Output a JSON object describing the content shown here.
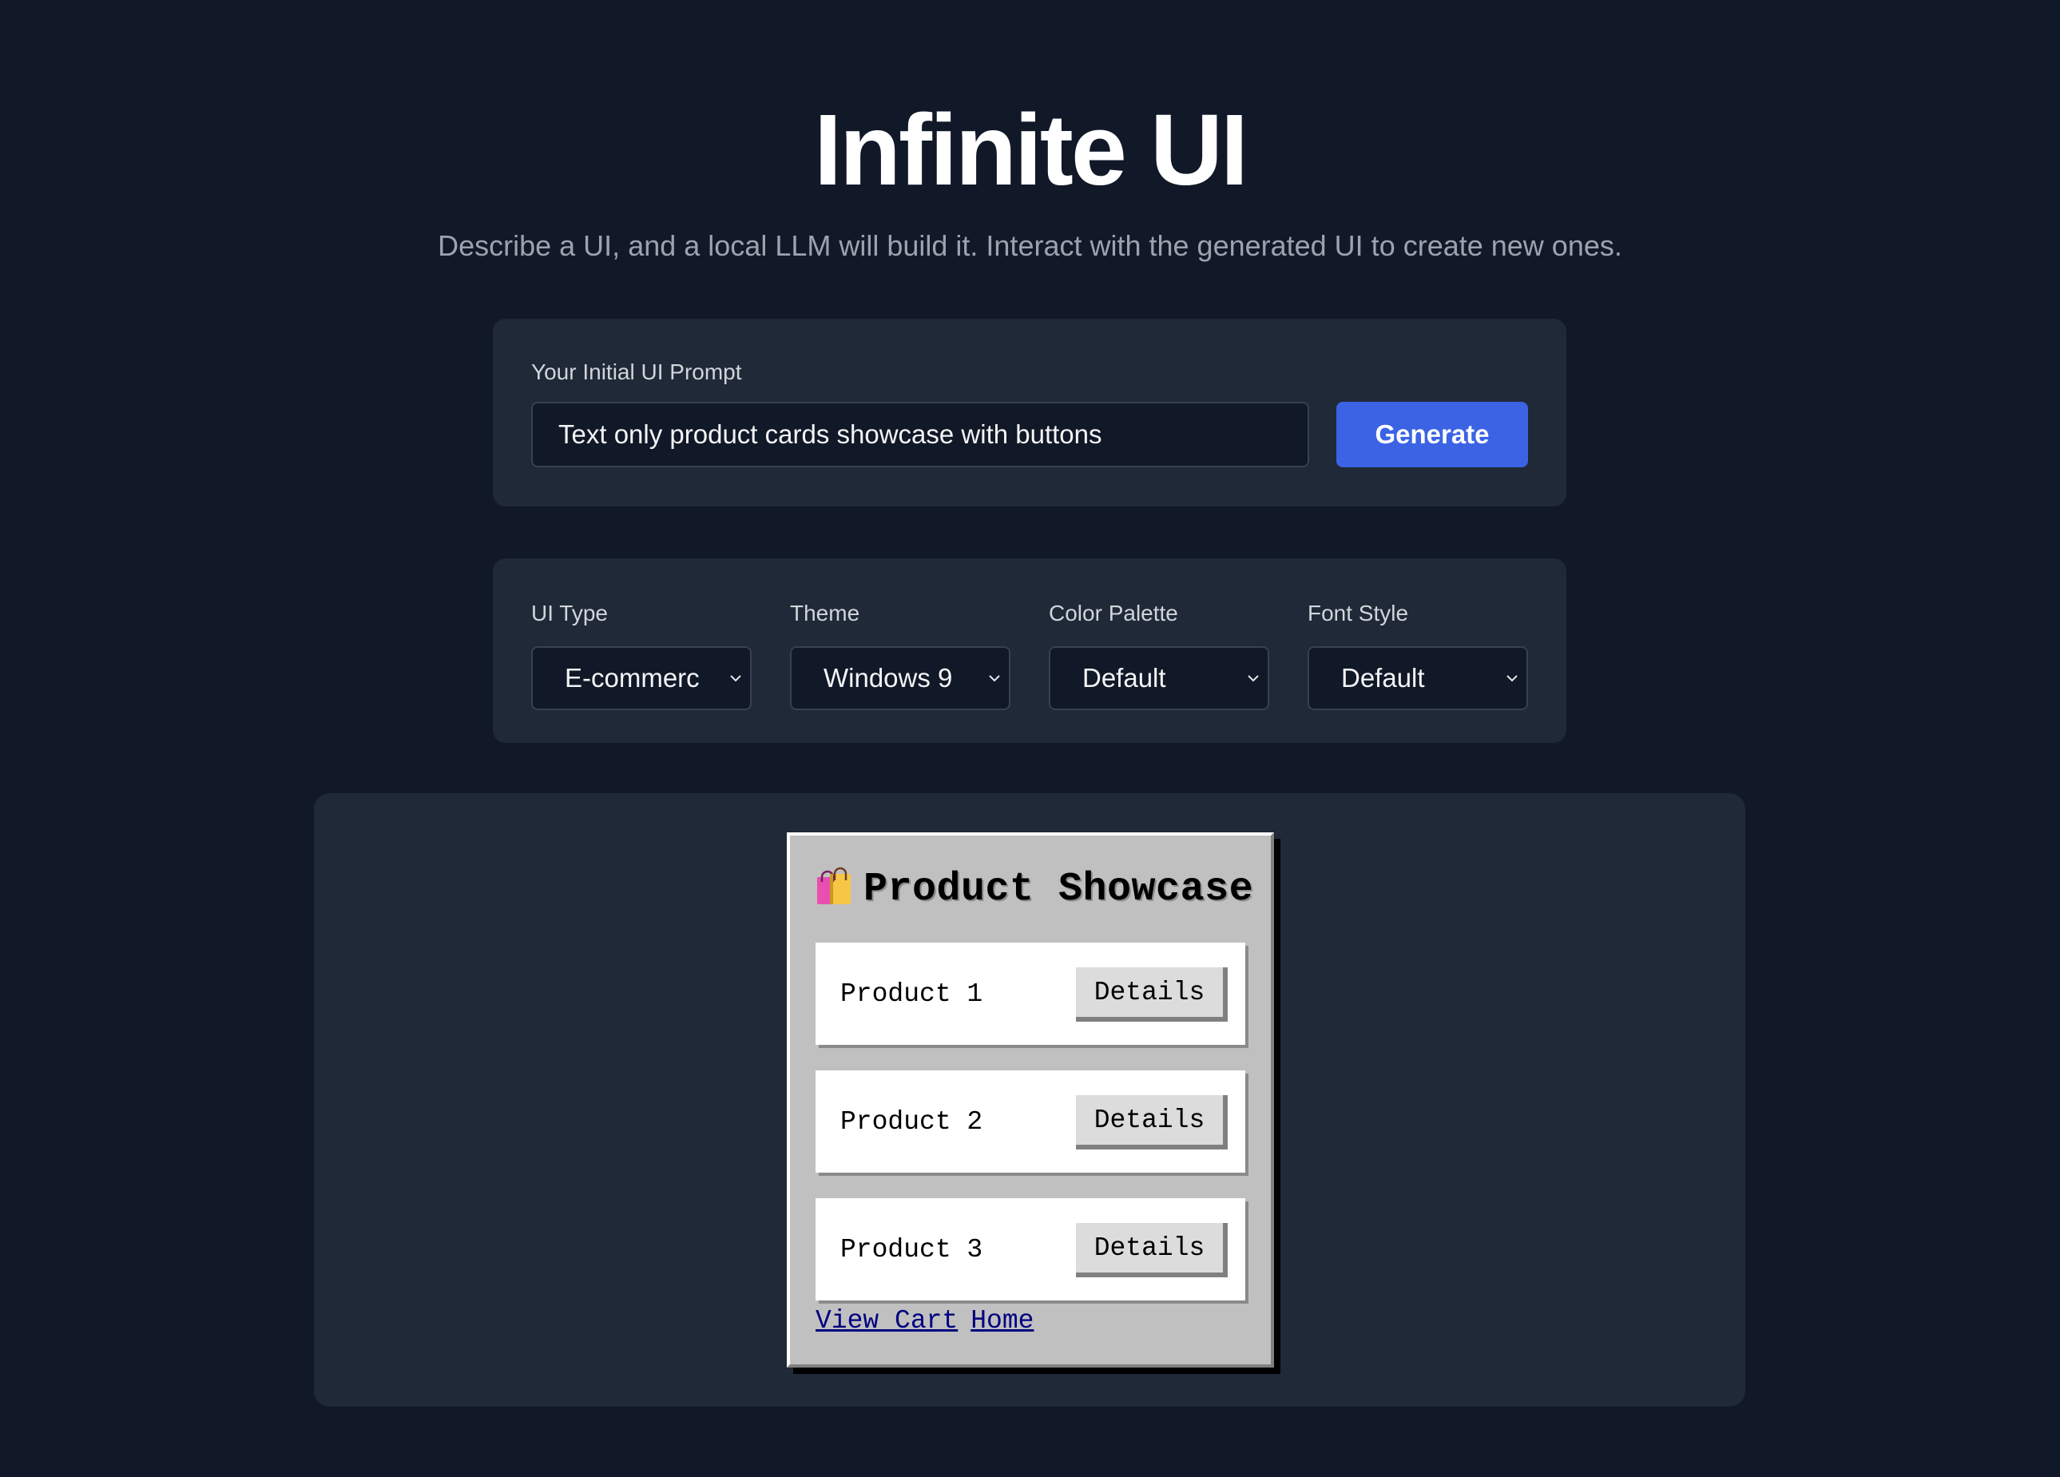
{
  "header": {
    "title": "Infinite UI",
    "subtitle": "Describe a UI, and a local LLM will build it. Interact with the generated UI to create new ones."
  },
  "prompt": {
    "label": "Your Initial UI Prompt",
    "value": "Text only product cards showcase with buttons",
    "generate_label": "Generate"
  },
  "options": [
    {
      "label": "UI Type",
      "value": "E-commerc"
    },
    {
      "label": "Theme",
      "value": "Windows 9"
    },
    {
      "label": "Color Palette",
      "value": "Default"
    },
    {
      "label": "Font Style",
      "value": "Default"
    }
  ],
  "preview": {
    "title": "Product Showcase",
    "icon": "shopping-bags-icon",
    "cards": [
      {
        "name": "Product 1",
        "button": "Details"
      },
      {
        "name": "Product 2",
        "button": "Details"
      },
      {
        "name": "Product 3",
        "button": "Details"
      }
    ],
    "links": [
      "View Cart",
      "Home"
    ]
  },
  "colors": {
    "background": "#111827",
    "panel": "#1f2937",
    "accent": "#3b63e4",
    "win95_gray": "#c0c0c0",
    "link": "#000080"
  }
}
